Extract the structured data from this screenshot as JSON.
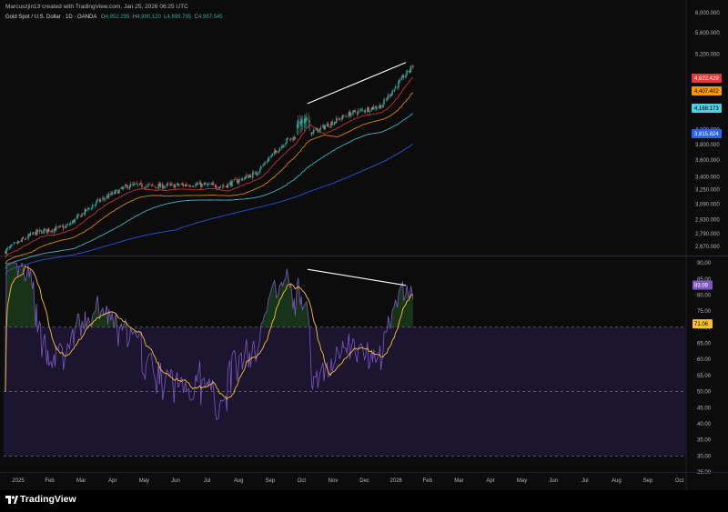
{
  "credit": "Marcuszjin13 created with TradingView.com, Jan 25, 2026 06:25 UTC",
  "symbol": {
    "name": "Gold Spot / U.S. Dollar · 1D · OANDA",
    "o_label": "O",
    "o_value": "4,952.295",
    "h_label": "H",
    "h_value": "4,990.120",
    "l_label": "L",
    "l_value": "4,899.795",
    "c_label": "C",
    "c_value": "4,987.545"
  },
  "branding": "TradingView",
  "colors": {
    "background": "#0c0c0c",
    "up": "#26a69a",
    "down": "#ef5350",
    "ma_fast": "#e53935",
    "ma_mid": "#ff9800",
    "ma_slow": "#4dd0e1",
    "ma_long": "#2962ff",
    "rsi": "#7e57c2",
    "rsi_ma": "#fbc02d",
    "rsi_band": "#1b1530",
    "trendline": "#ffffff"
  },
  "chart_data": [
    {
      "type": "candlestick",
      "price_scale": "log",
      "ylim": [
        2620,
        6000
      ],
      "y_ticks": [
        "6,000.000",
        "5,600.000",
        "5,200.000",
        "4,800.000",
        "4,000.000",
        "3,800.000",
        "3,600.000",
        "3,400.000",
        "3,250.000",
        "3,090.000",
        "2,930.000",
        "2,790.000",
        "2,670.000"
      ],
      "price_badges": [
        {
          "value": "4,622.429",
          "color": "#e53935",
          "text_color": "#ffffff"
        },
        {
          "value": "4,407.402",
          "color": "#ff9800",
          "text_color": "#000000"
        },
        {
          "value": "4,168.173",
          "color": "#4dd0e1",
          "text_color": "#000000"
        },
        {
          "value": "3,815.824",
          "color": "#2962ff",
          "text_color": "#ffffff"
        }
      ],
      "price_path_monthly": [
        {
          "month": "2025-01",
          "close": 2800
        },
        {
          "month": "2025-02",
          "close": 2860
        },
        {
          "month": "2025-03",
          "close": 3120
        },
        {
          "month": "2025-04",
          "close": 3300
        },
        {
          "month": "2025-05",
          "close": 3290
        },
        {
          "month": "2025-06",
          "close": 3310
        },
        {
          "month": "2025-07",
          "close": 3290
        },
        {
          "month": "2025-08",
          "close": 3440
        },
        {
          "month": "2025-09",
          "close": 3860
        },
        {
          "month": "2025-10",
          "close": 4000
        },
        {
          "month": "2025-11",
          "close": 4230
        },
        {
          "month": "2025-12",
          "close": 4350
        },
        {
          "month": "2026-01",
          "close": 4987.545
        }
      ],
      "trendline": {
        "from": {
          "date": "2025-10-20",
          "price": 4380
        },
        "to": {
          "date": "2026-01-23",
          "price": 5050
        }
      }
    },
    {
      "type": "line",
      "indicator": "RSI",
      "ylim": [
        25,
        92
      ],
      "y_ticks": [
        "90.00",
        "85.00",
        "80.00",
        "75.00",
        "70.00",
        "65.00",
        "60.00",
        "55.00",
        "50.00",
        "45.00",
        "40.00",
        "35.00",
        "30.00",
        "25.00"
      ],
      "levels": [
        70,
        50,
        30
      ],
      "badges": [
        {
          "value": "83.09",
          "color": "#7e57c2",
          "text_color": "#ffffff"
        },
        {
          "value": "71.06",
          "color": "#fbc02d",
          "text_color": "#000000"
        }
      ],
      "trendline": {
        "from": {
          "date": "2025-10-20",
          "value": 88
        },
        "to": {
          "date": "2026-01-23",
          "value": 83
        }
      }
    }
  ],
  "x_axis": {
    "labels": [
      "2025",
      "Feb",
      "Mar",
      "Apr",
      "May",
      "Jun",
      "Jul",
      "Aug",
      "Sep",
      "Oct",
      "Nov",
      "Dec",
      "2026",
      "Feb",
      "Mar",
      "Apr",
      "May",
      "Jun",
      "Jul",
      "Aug",
      "Sep",
      "Oct"
    ]
  }
}
